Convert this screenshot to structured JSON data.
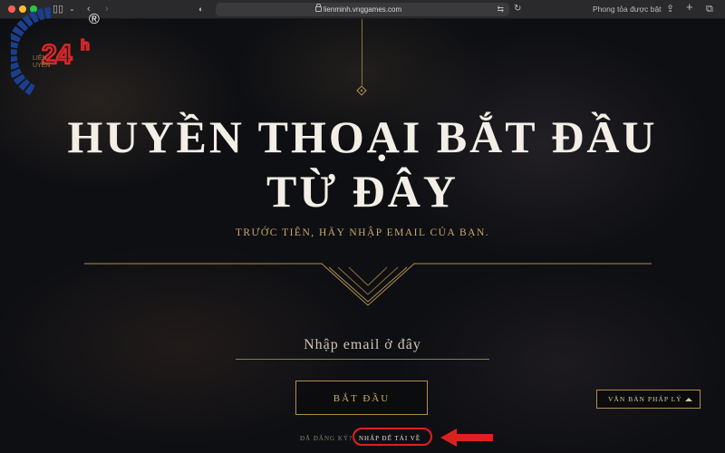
{
  "browser": {
    "url": "lienminh.vnggames.com",
    "block_label": "Phong tỏa được bật",
    "icons": [
      "sidebar-icon",
      "chevron-down-icon",
      "back-icon",
      "forward-icon",
      "shield-icon",
      "lock-icon",
      "translate-icon",
      "reload-icon",
      "share-icon",
      "new-tab-icon",
      "tabs-overview-icon"
    ]
  },
  "hero": {
    "line1": "HUYỀN THOẠI BẮT ĐẦU",
    "line2": "TỪ ĐÂY",
    "subtitle": "TRƯỚC TIÊN, HÃY NHẬP EMAIL CỦA BẠN."
  },
  "form": {
    "email_placeholder": "Nhập email ở đây",
    "email_value": "",
    "submit_label": "BẮT ĐẦU"
  },
  "footer": {
    "registered_text": "ĐÃ ĐĂNG KÝ?",
    "download_link": "NHẤP ĐỂ TẢI VỀ",
    "legal_label": "VĂN BẢN PHÁP LÝ"
  },
  "watermark": {
    "text": "LIÊN MINH HUYỀN THOẠI 24h ®"
  },
  "colors": {
    "gold": "#c9aa6a",
    "annotation_red": "#e0201f",
    "background": "#0e0f13"
  }
}
